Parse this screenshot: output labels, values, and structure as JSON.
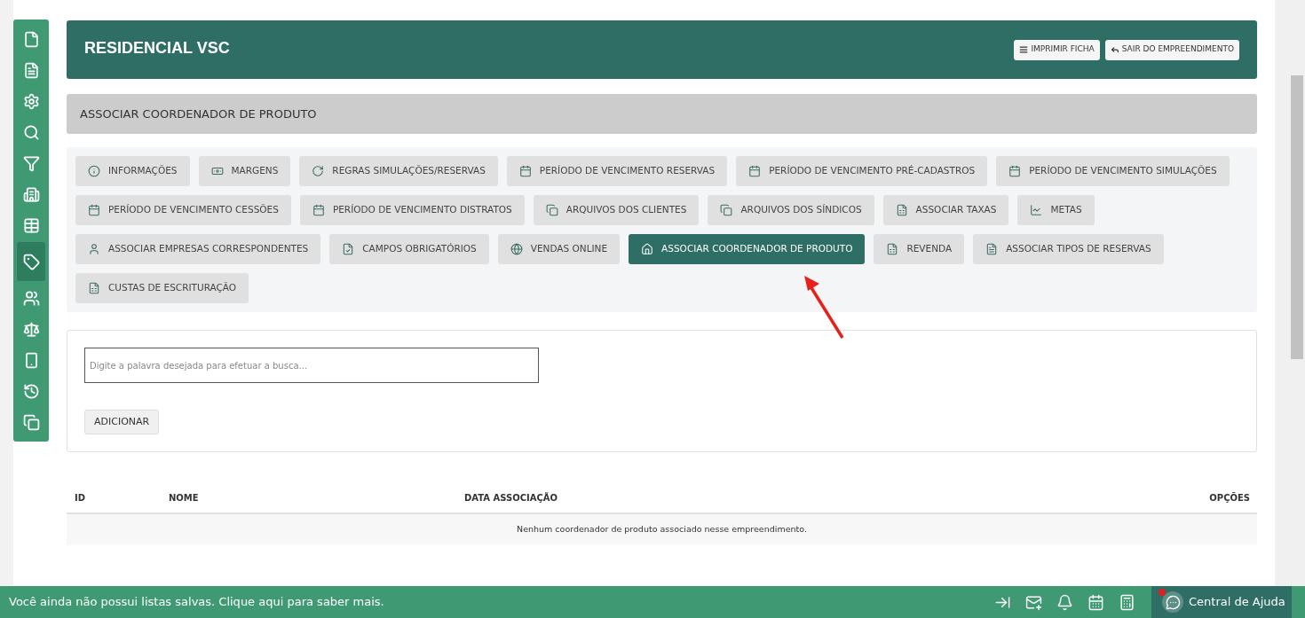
{
  "sidebar": {
    "items": [
      {
        "selected": false
      },
      {
        "selected": false
      },
      {
        "selected": false
      },
      {
        "selected": false
      },
      {
        "selected": false
      },
      {
        "selected": false
      },
      {
        "selected": false
      },
      {
        "selected": true
      },
      {
        "selected": false
      },
      {
        "selected": false
      },
      {
        "selected": false
      },
      {
        "selected": false
      },
      {
        "selected": false
      }
    ]
  },
  "header": {
    "title": "RESIDENCIAL VSC",
    "buttons": [
      "IMPRIMIR FICHA",
      "SAIR DO EMPREENDIMENTO"
    ]
  },
  "section_title": "ASSOCIAR COORDENADOR DE PRODUTO",
  "tabs": [
    {
      "label": "INFORMAÇÕES",
      "selected": false
    },
    {
      "label": "MARGENS",
      "selected": false
    },
    {
      "label": "REGRAS SIMULAÇÕES/RESERVAS",
      "selected": false
    },
    {
      "label": "PERÍODO DE VENCIMENTO RESERVAS",
      "selected": false
    },
    {
      "label": "PERÍODO DE VENCIMENTO PRÉ-CADASTROS",
      "selected": false
    },
    {
      "label": "PERÍODO DE VENCIMENTO SIMULAÇÕES",
      "selected": false
    },
    {
      "label": "PERÍODO DE VENCIMENTO CESSÕES",
      "selected": false
    },
    {
      "label": "PERÍODO DE VENCIMENTO DISTRATOS",
      "selected": false
    },
    {
      "label": "ARQUIVOS DOS CLIENTES",
      "selected": false
    },
    {
      "label": "ARQUIVOS DOS SÍNDICOS",
      "selected": false
    },
    {
      "label": "ASSOCIAR TAXAS",
      "selected": false
    },
    {
      "label": "METAS",
      "selected": false
    },
    {
      "label": "ASSOCIAR EMPRESAS CORRESPONDENTES",
      "selected": false
    },
    {
      "label": "CAMPOS OBRIGATÓRIOS",
      "selected": false
    },
    {
      "label": "VENDAS ONLINE",
      "selected": false
    },
    {
      "label": "ASSOCIAR COORDENADOR DE PRODUTO",
      "selected": true
    },
    {
      "label": "REVENDA",
      "selected": false
    },
    {
      "label": "ASSOCIAR TIPOS DE RESERVAS",
      "selected": false
    },
    {
      "label": "CUSTAS DE ESCRITURAÇÃO",
      "selected": false
    }
  ],
  "search": {
    "placeholder": "Digite a palavra desejada para efetuar a busca..."
  },
  "add_button": "ADICIONAR",
  "table": {
    "columns": [
      "ID",
      "NOME",
      "DATA ASSOCIAÇÃO",
      "OPÇÕES"
    ],
    "empty_message": "Nenhum coordenador de produto associado nesse empreendimento."
  },
  "status_bar": {
    "message": "Você ainda não possui listas salvas. Clique aqui para saber mais.",
    "help": {
      "label": "Central de Ajuda",
      "notification": true
    }
  }
}
